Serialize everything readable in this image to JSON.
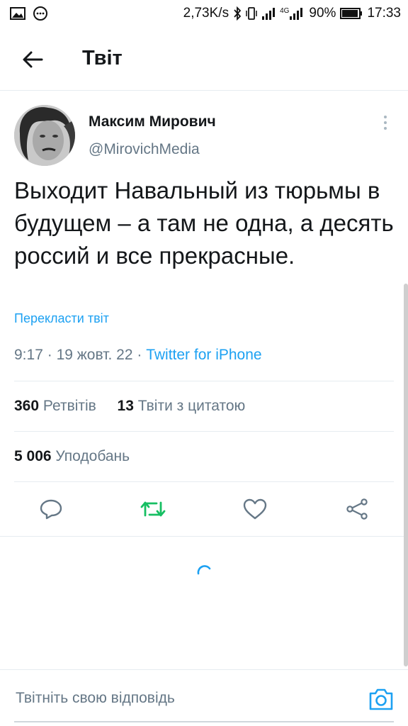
{
  "status_bar": {
    "net_speed": "2,73K/s",
    "network": "4G",
    "battery": "90%",
    "time": "17:33",
    "icons": [
      "gallery-icon",
      "chat-bubble-icon",
      "bluetooth-icon",
      "vibrate-icon",
      "signal-icon",
      "signal-4g-icon",
      "battery-icon"
    ]
  },
  "header": {
    "back_icon": "arrow-left-icon",
    "title": "Твіт"
  },
  "tweet": {
    "author_name": "Максим Мирович",
    "author_handle": "@MirovichMedia",
    "text": "Выходит Навальный из тюрьмы в будущем – а там не одна, а десять россий и все прекрасные.",
    "translate_label": "Перекласти твіт",
    "time": "9:17",
    "date": "19 жовт. 22",
    "separator": "·",
    "client": "Twitter for iPhone"
  },
  "stats": {
    "retweets_count": "360",
    "retweets_label": "Ретвітів",
    "quotes_count": "13",
    "quotes_label": "Твіти з цитатою",
    "likes_count": "5 006",
    "likes_label": "Уподобань"
  },
  "actions": {
    "icons": [
      "reply-icon",
      "retweet-icon",
      "like-icon",
      "share-icon"
    ],
    "retweet_color": "#17bf63",
    "icon_color": "#657786"
  },
  "reply": {
    "placeholder": "Твітніть свою відповідь",
    "camera_icon": "camera-icon"
  },
  "colors": {
    "accent": "#1da1f2",
    "text": "#14171a",
    "secondary": "#657786",
    "divider": "#e6ecf0"
  }
}
